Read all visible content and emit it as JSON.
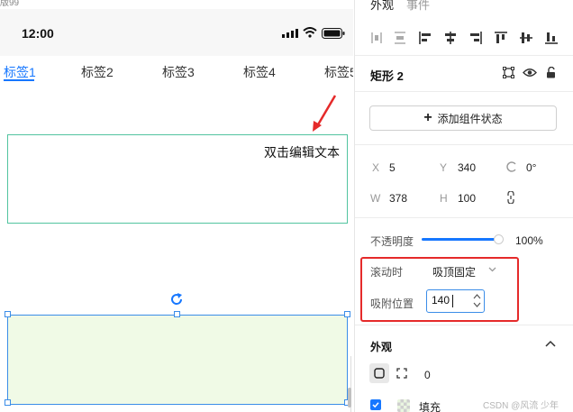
{
  "canvas": {
    "top_cut_text": "版99",
    "status": {
      "time": "12:00"
    },
    "tabs": [
      {
        "label": "标签1",
        "active": true
      },
      {
        "label": "标签2",
        "active": false
      },
      {
        "label": "标签3",
        "active": false
      },
      {
        "label": "标签4",
        "active": false
      },
      {
        "label": "标签5",
        "active": false
      }
    ],
    "text_box": {
      "text": "双击编辑文本"
    },
    "colors": {
      "accent": "#1677ff",
      "selected_fill": "#f0fae6",
      "annotation": "#e52a2a"
    }
  },
  "panel": {
    "tabs": [
      "外观",
      "事件"
    ],
    "layer": {
      "name": "矩形 2"
    },
    "add_state_label": "添加组件状态",
    "geometry": {
      "x_label": "X",
      "x": "5",
      "y_label": "Y",
      "y": "340",
      "rotation": "0°",
      "w_label": "W",
      "w": "378",
      "h_label": "H",
      "h": "100"
    },
    "opacity": {
      "label": "不透明度",
      "value": "100%",
      "level": 1.0
    },
    "scroll": {
      "label": "滚动时",
      "value": "吸顶固定"
    },
    "sticky": {
      "label": "吸附位置",
      "value": "140"
    },
    "appearance": {
      "title": "外观",
      "corner_radius": "0"
    },
    "fill": {
      "label": "填充",
      "checked": true
    },
    "watermark": "CSDN @风流 少年"
  }
}
